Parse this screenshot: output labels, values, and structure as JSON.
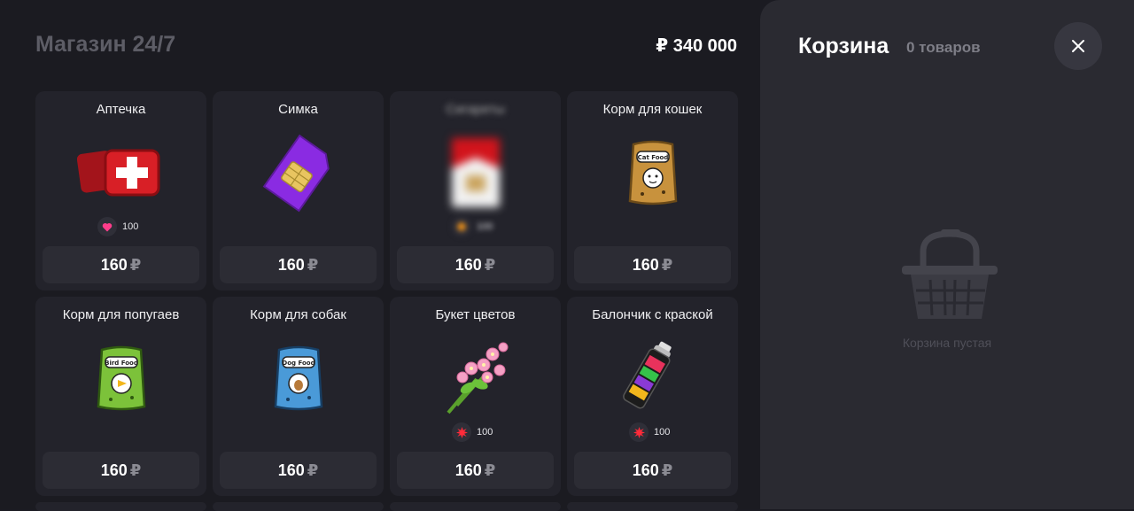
{
  "shop": {
    "title": "Магазин 24/7",
    "balance": "₽ 340 000"
  },
  "items": [
    {
      "name": "Аптечка",
      "icon": "first-aid-kit-icon",
      "price": "160",
      "currency": "₽",
      "stat": {
        "icon": "heart-icon",
        "value": "100"
      }
    },
    {
      "name": "Симка",
      "icon": "sim-card-icon",
      "price": "160",
      "currency": "₽"
    },
    {
      "name": "Сигареты",
      "icon": "cigarettes-icon",
      "price": "160",
      "currency": "₽",
      "stat": {
        "icon": "stat-icon",
        "value": "100"
      },
      "blurred": true
    },
    {
      "name": "Корм для кошек",
      "icon": "cat-food-icon",
      "price": "160",
      "currency": "₽"
    },
    {
      "name": "Корм для попугаев",
      "icon": "bird-food-icon",
      "price": "160",
      "currency": "₽"
    },
    {
      "name": "Корм для собак",
      "icon": "dog-food-icon",
      "price": "160",
      "currency": "₽"
    },
    {
      "name": "Букет цветов",
      "icon": "flower-bouquet-icon",
      "price": "160",
      "currency": "₽",
      "stat": {
        "icon": "burst-icon",
        "value": "100"
      }
    },
    {
      "name": "Балончик с краской",
      "icon": "spray-can-icon",
      "price": "160",
      "currency": "₽",
      "stat": {
        "icon": "burst-icon",
        "value": "100"
      }
    }
  ],
  "cart": {
    "title": "Корзина",
    "count": "0 товаров",
    "empty_text": "Корзина пустая",
    "close_icon": "close-icon"
  },
  "colors": {
    "background": "#1b1b21",
    "card": "#23232b",
    "price_button": "#2c2c34",
    "cart_panel": "#2a2a31",
    "heart": "#ff3d8b",
    "burst": "#ff2b3a"
  }
}
